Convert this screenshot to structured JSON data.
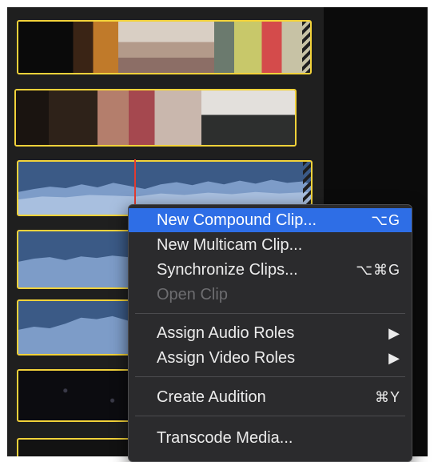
{
  "menu": {
    "items": [
      {
        "label": "New Compound Clip...",
        "shortcut": "⌥G",
        "highlighted": true
      },
      {
        "label": "New Multicam Clip...",
        "shortcut": ""
      },
      {
        "label": "Synchronize Clips...",
        "shortcut": "⌥⌘G"
      },
      {
        "label": "Open Clip",
        "shortcut": "",
        "disabled": true
      },
      {
        "label": "Assign Audio Roles",
        "submenu": "▶"
      },
      {
        "label": "Assign Video Roles",
        "submenu": "▶"
      },
      {
        "label": "Create Audition",
        "shortcut": "⌘Y"
      },
      {
        "label": "Transcode Media...",
        "shortcut": ""
      }
    ]
  },
  "colors": {
    "clip_border": "#f2d23a",
    "highlight": "#2e6ee6",
    "audio_fill": "#3b5a86",
    "playhead": "#e23b30"
  }
}
